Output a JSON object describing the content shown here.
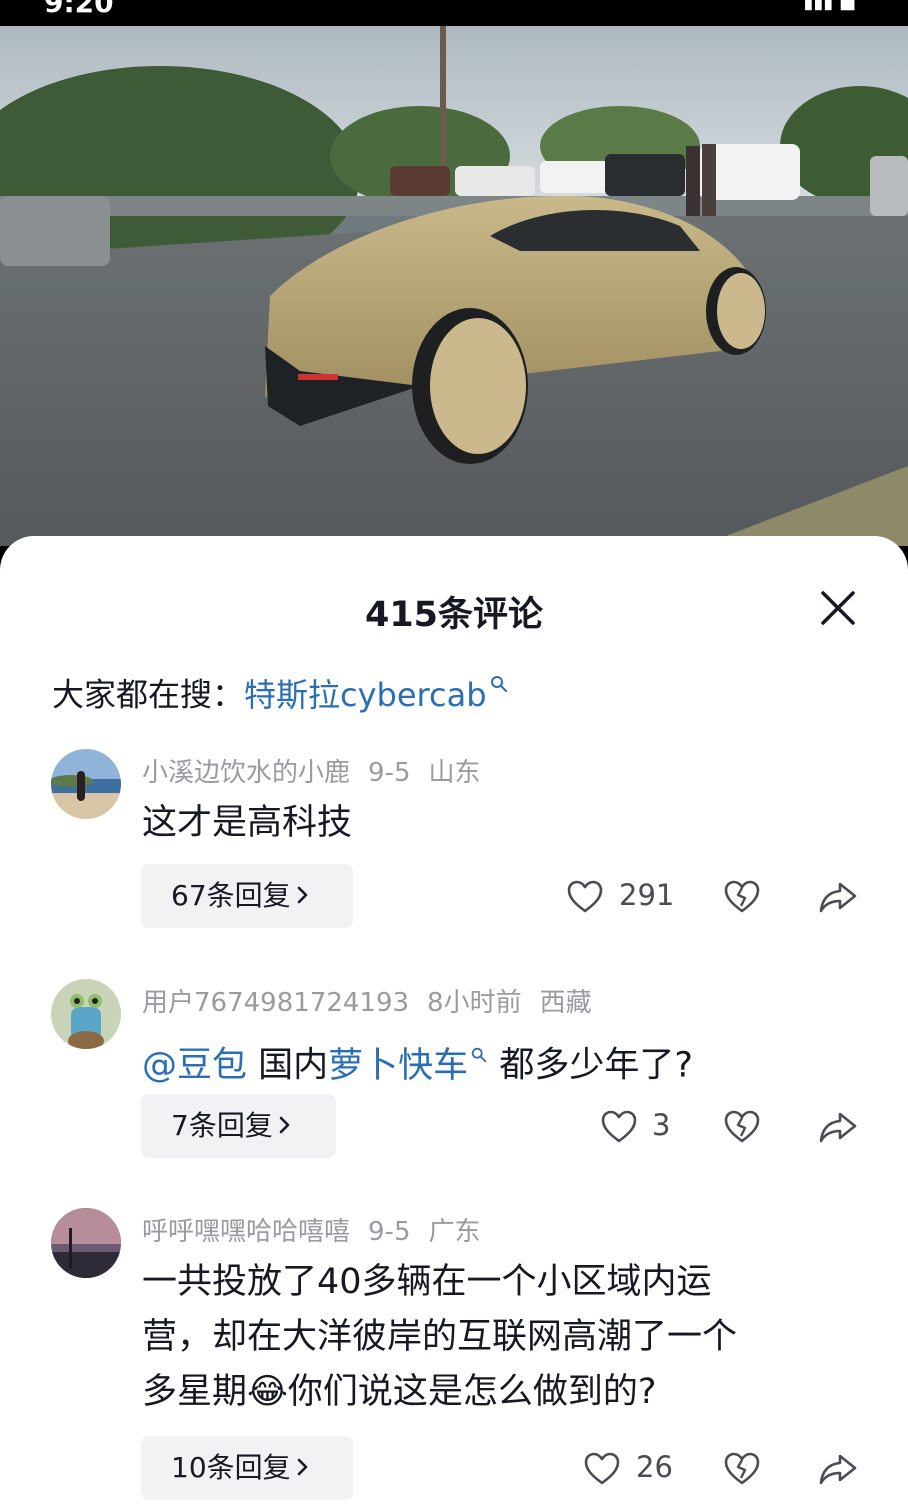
{
  "status": {
    "time": "9:20",
    "right": "▮▮▮ ■"
  },
  "sheet": {
    "title": "415条评论",
    "hot_search_prefix": "大家都在搜：",
    "hot_search_term": "特斯拉cybercab"
  },
  "comments": [
    {
      "user": "小溪边饮水的小鹿",
      "time": "9-5",
      "location": "山东",
      "text": "这才是高科技",
      "replies": "67条回复",
      "likes": "291"
    },
    {
      "user": "用户7674981724193",
      "time": "8小时前",
      "location": "西藏",
      "mention": "@豆包",
      "text_a": "国内",
      "link": "萝卜快车",
      "text_b": "都多少年了?",
      "replies": "7条回复",
      "likes": "3"
    },
    {
      "user": "呼呼嘿嘿哈哈嘻嘻",
      "time": "9-5",
      "location": "广东",
      "line1": "一共投放了40多辆在一个小区域内运",
      "line2": "营，却在大洋彼岸的互联网高潮了一个",
      "line3a": "多星期",
      "emoji": "😂",
      "line3b": "你们说这是怎么做到的?",
      "replies": "10条回复",
      "likes": "26"
    }
  ],
  "icons": {
    "close": "close-icon",
    "search": "search-icon",
    "like": "heart-icon",
    "dislike": "broken-heart-icon",
    "share": "share-icon",
    "chevron": "chevron-right-icon"
  },
  "colors": {
    "link": "#2a6fb5",
    "meta": "#9a9aa1",
    "text": "#161823",
    "reply_bg": "#f2f2f4"
  }
}
